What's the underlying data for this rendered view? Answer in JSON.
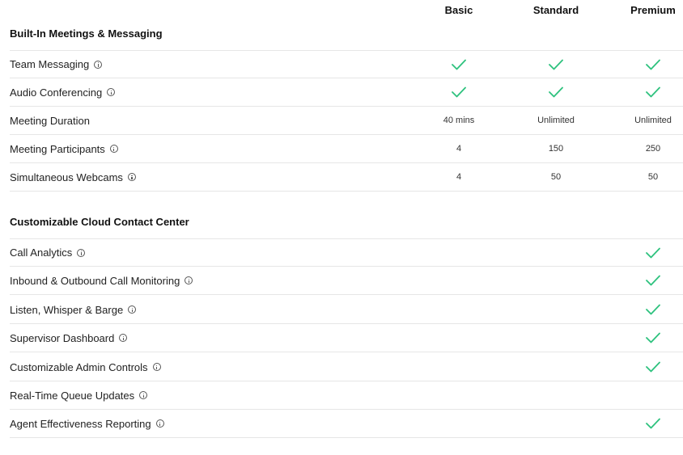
{
  "plans": [
    "Basic",
    "Standard",
    "Premium"
  ],
  "sections": [
    {
      "title": "Built-In Meetings & Messaging",
      "rows": [
        {
          "label": "Team Messaging",
          "info": true,
          "cells": [
            "check",
            "check",
            "check"
          ]
        },
        {
          "label": "Audio Conferencing",
          "info": true,
          "cells": [
            "check",
            "check",
            "check"
          ]
        },
        {
          "label": "Meeting Duration",
          "info": false,
          "cells": [
            "40 mins",
            "Unlimited",
            "Unlimited"
          ]
        },
        {
          "label": "Meeting Participants",
          "info": true,
          "cells": [
            "4",
            "150",
            "250"
          ]
        },
        {
          "label": "Simultaneous Webcams",
          "info": true,
          "cells": [
            "4",
            "50",
            "50"
          ]
        }
      ]
    },
    {
      "title": "Customizable Cloud Contact Center",
      "rows": [
        {
          "label": "Call Analytics",
          "info": true,
          "cells": [
            "",
            "",
            "check"
          ]
        },
        {
          "label": "Inbound & Outbound Call Monitoring",
          "info": true,
          "cells": [
            "",
            "",
            "check"
          ]
        },
        {
          "label": "Listen, Whisper & Barge",
          "info": true,
          "cells": [
            "",
            "",
            "check"
          ]
        },
        {
          "label": "Supervisor Dashboard",
          "info": true,
          "cells": [
            "",
            "",
            "check"
          ]
        },
        {
          "label": "Customizable Admin Controls",
          "info": true,
          "cells": [
            "",
            "",
            "check"
          ]
        },
        {
          "label": "Real-Time Queue Updates",
          "info": true,
          "cells": [
            "",
            "",
            ""
          ]
        },
        {
          "label": "Agent Effectiveness Reporting",
          "info": true,
          "cells": [
            "",
            "",
            "check"
          ]
        }
      ]
    }
  ],
  "colors": {
    "check": "#2ec27e",
    "divider": "#e6e6e6"
  }
}
